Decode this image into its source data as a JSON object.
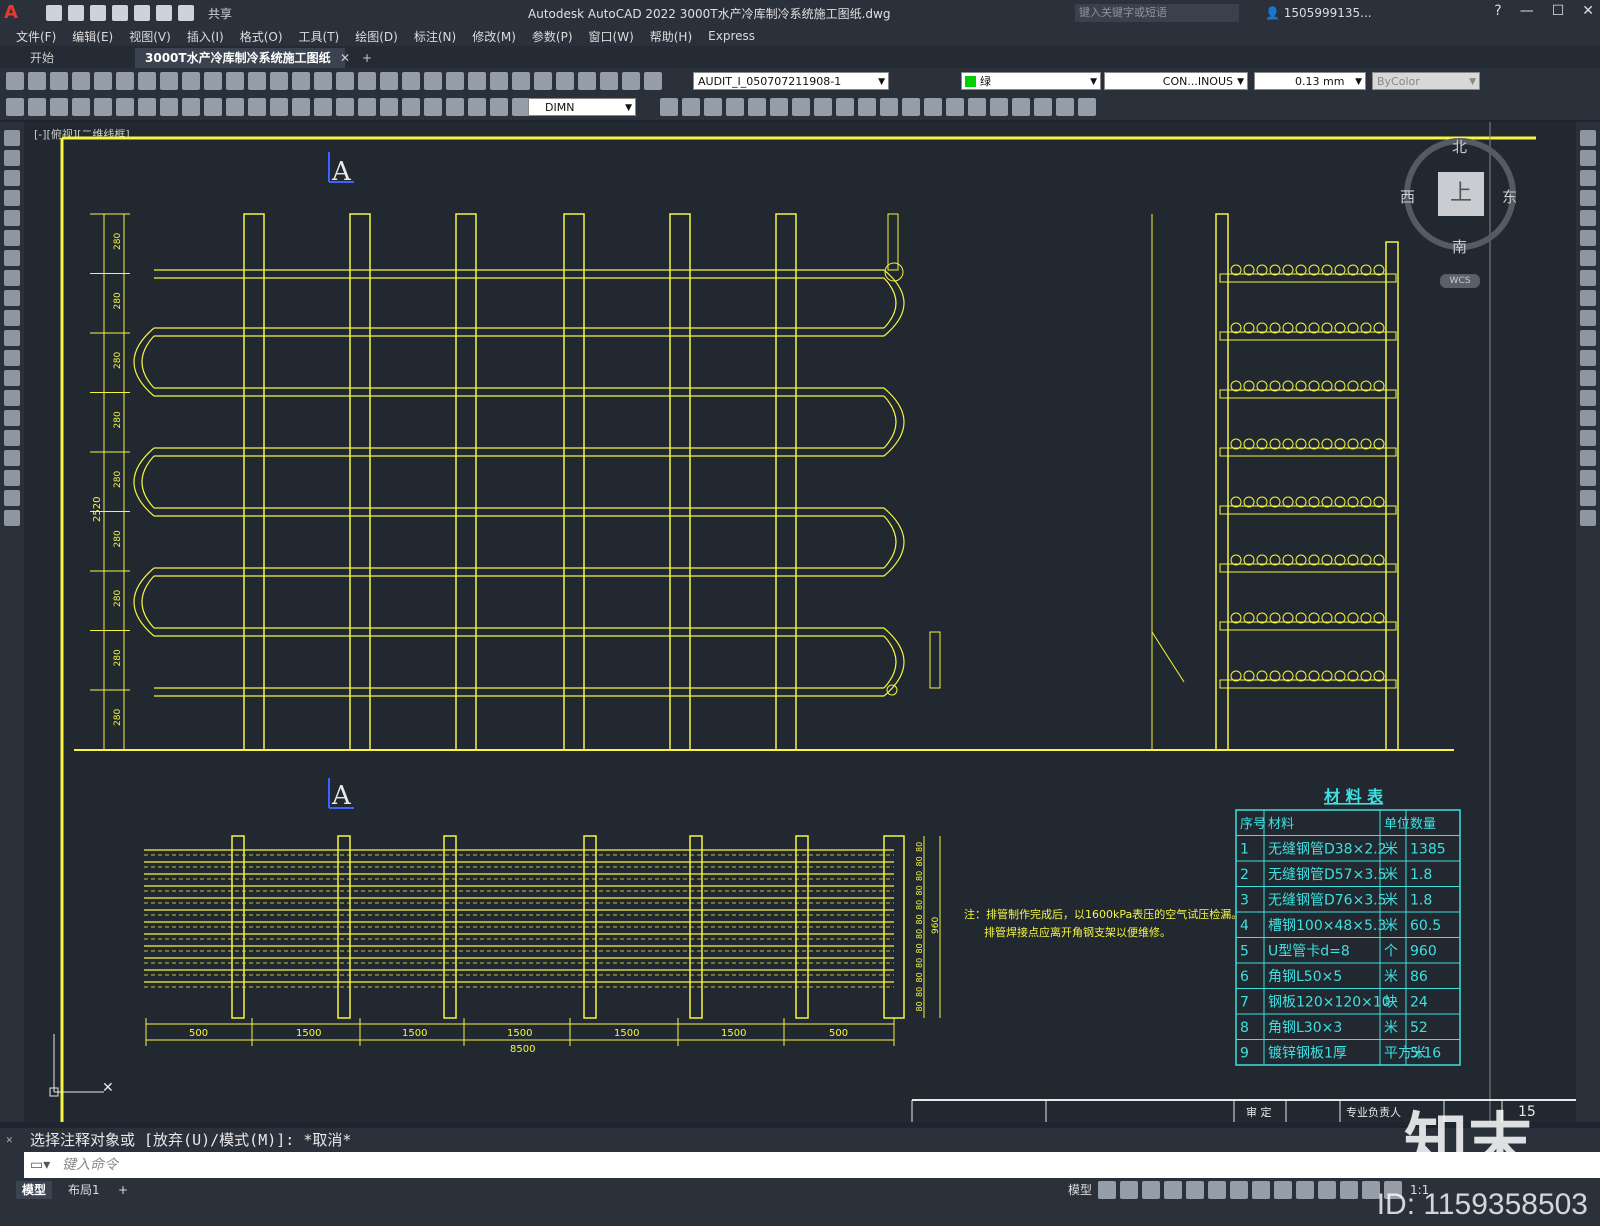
{
  "titlebar": {
    "app_title": "Autodesk AutoCAD 2022    3000T水产冷库制冷系统施工图纸.dwg",
    "share": "共享",
    "search_placeholder": "键入关键字或短语",
    "user": "1505999135...",
    "help": "?"
  },
  "menu": [
    "文件(F)",
    "编辑(E)",
    "视图(V)",
    "插入(I)",
    "格式(O)",
    "工具(T)",
    "绘图(D)",
    "标注(N)",
    "修改(M)",
    "参数(P)",
    "窗口(W)",
    "帮助(H)",
    "Express"
  ],
  "tabs": {
    "start": "开始",
    "active": "3000T水产冷库制冷系统施工图纸*"
  },
  "toolbar": {
    "layer": "AUDIT_I_050707211908-1",
    "color": "绿",
    "linetype": "CON...INOUS",
    "lineweight": "0.13 mm",
    "plotstyle": "ByColor",
    "dimstyle": "DIMN"
  },
  "viewport": {
    "label": "[-][俯视][二维线框]",
    "viewcube": {
      "north": "北",
      "south": "南",
      "east": "东",
      "west": "西",
      "top": "上",
      "wcs": "WCS"
    },
    "section_top": "A",
    "section_bottom": "A",
    "dims_vertical": [
      "280",
      "280",
      "280",
      "280",
      "280",
      "280",
      "280",
      "280",
      "280"
    ],
    "dim_total_vertical": "2520",
    "dims_bottom": [
      "500",
      "1500",
      "1500",
      "1500",
      "1500",
      "1500",
      "500"
    ],
    "dim_total_bottom": "8500",
    "dims_right": [
      "80",
      "80",
      "80",
      "80",
      "80",
      "80",
      "80",
      "80",
      "80",
      "80",
      "80",
      "80"
    ],
    "dim_right_total": "960",
    "note_line1": "注：排管制作完成后，以1600kPa表压的空气试压检漏。",
    "note_line2": "排管焊接点应离开角钢支架以便维修。",
    "titleblock": {
      "cell1": "审 定",
      "cell2": "专业负责人",
      "page": "15"
    }
  },
  "material_table": {
    "title": "材 料 表",
    "headers": [
      "序号",
      "材料",
      "单位",
      "数量"
    ],
    "rows": [
      [
        "1",
        "无缝钢管D38×2.2",
        "米",
        "1385"
      ],
      [
        "2",
        "无缝钢管D57×3.5",
        "米",
        "1.8"
      ],
      [
        "3",
        "无缝钢管D76×3.5",
        "米",
        "1.8"
      ],
      [
        "4",
        "槽钢100×48×5.3",
        "米",
        "60.5"
      ],
      [
        "5",
        "U型管卡d=8",
        "个",
        "960"
      ],
      [
        "6",
        "角钢L50×5",
        "米",
        "86"
      ],
      [
        "7",
        "钢板120×120×10",
        "块",
        "24"
      ],
      [
        "8",
        "角钢L30×3",
        "米",
        "52"
      ],
      [
        "9",
        "镀锌钢板1厚",
        "平方米",
        "5.16"
      ]
    ]
  },
  "command": {
    "history": "选择注释对象或 [放弃(U)/模式(M)]: *取消*",
    "placeholder": "键入命令"
  },
  "status": {
    "model_tab": "模型",
    "layout_tab": "布局1",
    "model": "模型",
    "scale": "1:1"
  },
  "watermark": {
    "id": "ID: 1159358503",
    "brand": "知末"
  }
}
